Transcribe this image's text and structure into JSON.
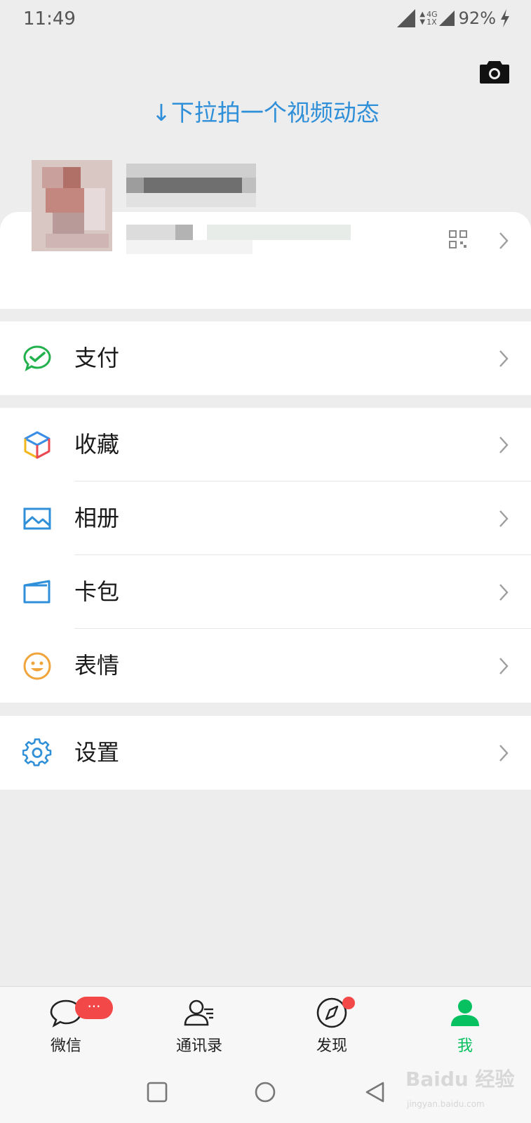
{
  "status_bar": {
    "time": "11:49",
    "network_top": "4G",
    "network_bottom": "1X",
    "battery": "92%"
  },
  "pull_hint": "↓下拉拍一个视频动态",
  "menu": {
    "pay": "支付",
    "favorites": "收藏",
    "album": "相册",
    "cards": "卡包",
    "stickers": "表情",
    "settings": "设置"
  },
  "tabs": {
    "chats": "微信",
    "chats_badge": "···",
    "contacts": "通讯录",
    "discover": "发现",
    "me": "我"
  },
  "watermark": {
    "text": "Baidu 经验",
    "url": "jingyan.baidu.com"
  },
  "colors": {
    "accent": "#07c160",
    "link": "#2f8fd8",
    "badge": "#f24848",
    "background": "#ededed"
  }
}
